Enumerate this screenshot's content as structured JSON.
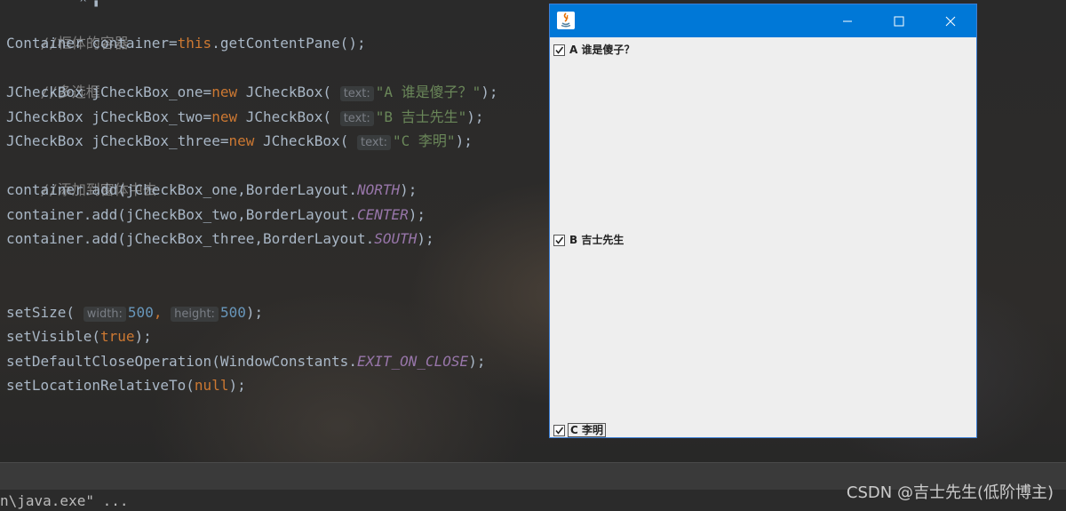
{
  "editor": {
    "lines": [
      {
        "id": "l1",
        "comment": "//框体的容器"
      },
      {
        "id": "l2",
        "text": "Container container=",
        "kw": "this",
        "rest": ".getContentPane();"
      },
      {
        "id": "l3",
        "comment": "//多选框"
      },
      {
        "id": "l4",
        "pre": "JCheckBox jCheckBox_one=",
        "kw": "new",
        "mid": " JCheckBox(",
        "hint": "text:",
        "str": "\"A 谁是傻子？\"",
        "end": ");"
      },
      {
        "id": "l5",
        "pre": "JCheckBox jCheckBox_two=",
        "kw": "new",
        "mid": " JCheckBox(",
        "hint": "text:",
        "str": "\"B 吉士先生\"",
        "end": ");"
      },
      {
        "id": "l6",
        "pre": "JCheckBox jCheckBox_three=",
        "kw": "new",
        "mid": " JCheckBox(",
        "hint": "text:",
        "str": "\"C 李明\"",
        "end": ");"
      },
      {
        "id": "l7",
        "comment": "//添加到窗体中去"
      },
      {
        "id": "l8",
        "pre": "container.add(jCheckBox_one,BorderLayout.",
        "const": "NORTH",
        "end": ");"
      },
      {
        "id": "l9",
        "pre": "container.add(jCheckBox_two,BorderLayout.",
        "const": "CENTER",
        "end": ");"
      },
      {
        "id": "l10",
        "pre": "container.add(jCheckBox_three,BorderLayout.",
        "const": "SOUTH",
        "end": ");"
      },
      {
        "id": "l11",
        "pre": "setSize(",
        "hint1": "width:",
        "num1": "500",
        "sep": ",",
        "hint2": "height:",
        "num2": "500",
        "end": ");"
      },
      {
        "id": "l12",
        "pre": "setVisible(",
        "kw": "true",
        "end": ");"
      },
      {
        "id": "l13",
        "pre": "setDefaultCloseOperation(WindowConstants.",
        "const": "EXIT_ON_CLOSE",
        "end": ");"
      },
      {
        "id": "l14",
        "pre": "setLocationRelativeTo(",
        "kw": "null",
        "end": ");"
      }
    ]
  },
  "console": {
    "text": "n\\java.exe\" ..."
  },
  "watermark": "CSDN @吉士先生(低阶博主)",
  "window": {
    "title_bar_color": "#0078d7",
    "buttons": {
      "minimize": "minimize-icon",
      "maximize": "maximize-icon",
      "close": "close-icon"
    },
    "checkboxes": [
      {
        "label": "A 谁是傻子？",
        "checked": true
      },
      {
        "label": "B 吉士先生",
        "checked": true
      },
      {
        "label": "C 李明",
        "checked": true
      }
    ]
  }
}
